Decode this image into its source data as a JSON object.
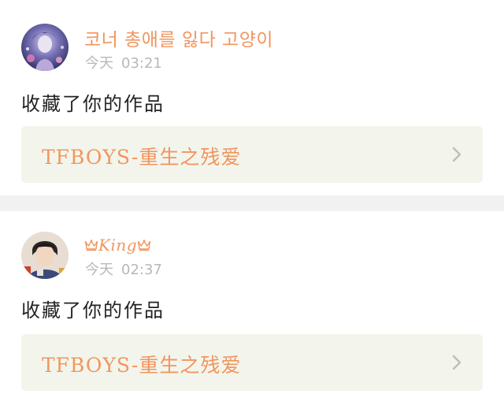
{
  "feed": {
    "items": [
      {
        "username": "코너 총애를 잃다 고양이",
        "time_day": "今天",
        "time_clock": "03:21",
        "message": "收藏了你的作品",
        "work_title": "TFBOYS-重生之残爱"
      },
      {
        "username": "King",
        "time_day": "今天",
        "time_clock": "02:37",
        "message": "收藏了你的作品",
        "work_title": "TFBOYS-重生之残爱"
      }
    ]
  },
  "colors": {
    "accent": "#f0965f",
    "link_background": "#f3f5ec",
    "divider": "#f1f1f1",
    "timestamp": "#b8b8b8",
    "chevron": "#bdbdbd"
  },
  "icons": {
    "crown": "crown-icon",
    "chevron": "chevron-right-icon"
  }
}
